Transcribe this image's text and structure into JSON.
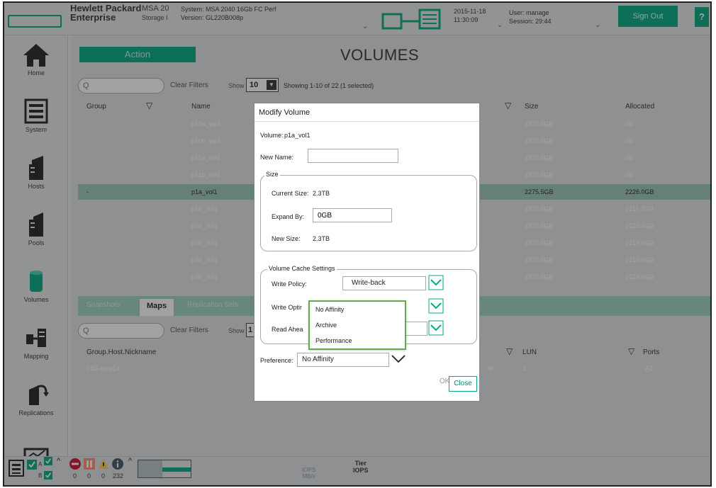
{
  "header": {
    "brand_line1": "Hewlett Packard",
    "brand_line2": "Enterprise",
    "model_line1": "MSA 20",
    "model_line2": "Storage I",
    "system": "System: MSA 2040 16Gb FC Perf",
    "version": "Version: GL220B008p",
    "date": "2015-11-18",
    "time": "11:30:09",
    "user": "User: manage",
    "session": "Session: 29:44",
    "sign_out": "Sign Out",
    "help": "?"
  },
  "sidebar": {
    "items": [
      {
        "label": "Home",
        "icon": "home-icon"
      },
      {
        "label": "System",
        "icon": "system-icon"
      },
      {
        "label": "Hosts",
        "icon": "hosts-icon"
      },
      {
        "label": "Pools",
        "icon": "pools-icon"
      },
      {
        "label": "Volumes",
        "icon": "volumes-icon"
      },
      {
        "label": "Mapping",
        "icon": "mapping-icon"
      },
      {
        "label": "Replications",
        "icon": "replications-icon"
      }
    ]
  },
  "main": {
    "action": "Action",
    "title": "VOLUMES",
    "search_placeholder": "Q",
    "clear_filters": "Clear Filters",
    "show_label": "Show",
    "show_value": "10",
    "showing": "Showing 1-10 of 22 (1 selected)",
    "columns": {
      "group": "Group",
      "name": "Name",
      "size": "Size",
      "allocated": "Allocated"
    },
    "rows": [
      {
        "group": "-",
        "name": "p10a_vol1",
        "size": "2275.5GB",
        "allocated": "0B"
      },
      {
        "group": "-",
        "name": "p10b_vol1",
        "size": "2275.5GB",
        "allocated": "0B"
      },
      {
        "group": "-",
        "name": "p11a_vol1",
        "size": "2275.5GB",
        "allocated": "0B"
      },
      {
        "group": "-",
        "name": "p11b_vol1",
        "size": "2275.5GB",
        "allocated": "0B"
      },
      {
        "group": "-",
        "name": "p1a_vol1",
        "size": "2275.5GB",
        "allocated": "2226.0GB"
      },
      {
        "group": "-",
        "name": "p1b_vol1",
        "size": "2275.5GB",
        "allocated": "2211.2GB"
      },
      {
        "group": "-",
        "name": "p2a_vol1",
        "size": "2275.5GB",
        "allocated": "2222.4GB"
      },
      {
        "group": "-",
        "name": "p2b_vol1",
        "size": "2275.5GB",
        "allocated": "2219.6GB"
      },
      {
        "group": "-",
        "name": "p3a_vol1",
        "size": "2275.5GB",
        "allocated": "2210.6GB"
      },
      {
        "group": "-",
        "name": "p3b_vol1",
        "size": "2275.5GB",
        "allocated": "2224.6GB"
      }
    ],
    "tabs": [
      "Snapshots",
      "Maps",
      "Replication Sets"
    ],
    "maps": {
      "search_placeholder": "Q",
      "clear_filters": "Clear Filters",
      "show_label": "Show",
      "show_value": "1",
      "columns": {
        "ghn": "Group.Host.Nickname",
        "lun": "LUN",
        "ports": "Ports"
      },
      "row": {
        "ghn": "16G-host1a",
        "tail": "te",
        "lun": "1",
        "ports": "A1"
      }
    }
  },
  "modal": {
    "title": "Modify Volume",
    "volume_label": "Volume:",
    "volume_value": "p1a_vol1",
    "new_name_label": "New Name:",
    "new_name_value": "",
    "size_group": "Size",
    "current_size_label": "Current Size:",
    "current_size_value": "2.3TB",
    "expand_by_label": "Expand By:",
    "expand_by_value": "0GB",
    "new_size_label": "New Size:",
    "new_size_value": "2.3TB",
    "cache_group": "Volume Cache Settings",
    "write_policy_label": "Write Policy:",
    "write_policy_value": "Write-back",
    "write_optim_label": "Write Optir",
    "read_ahead_label": "Read Ahea",
    "preference_label": "Preference:",
    "preference_value": "No Affinity",
    "dropdown_options": [
      "No Affinity",
      "Archive",
      "Performance"
    ],
    "ok": "OK",
    "close": "Close"
  },
  "statusbar": {
    "counts": [
      "0",
      "0",
      "0",
      "232"
    ],
    "iops": "IOPS",
    "mbs": "MB/s",
    "tier": "Tier",
    "tier_iops": "IOPS",
    "badge_a": "A",
    "badge_b": "B"
  },
  "colors": {
    "accent": "#01a982",
    "dropdown_border": "#5fae4a",
    "row_selected": "#9bc7b5"
  }
}
